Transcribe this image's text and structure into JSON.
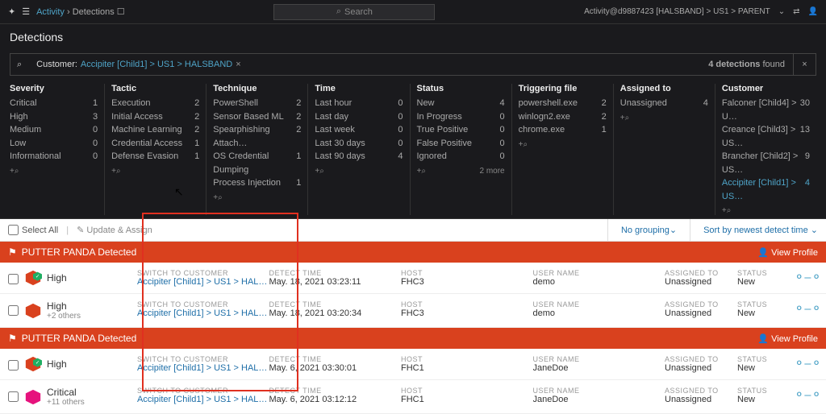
{
  "top": {
    "breadcrumb_root": "Activity",
    "breadcrumb_leaf": "Detections",
    "search_placeholder": "Search",
    "context": "Activity@d9887423  [HALSBAND] > US1 > PARENT"
  },
  "page_title": "Detections",
  "filter": {
    "label": "Customer:",
    "value": "Accipiter [Child1] > US1 > HALSBAND",
    "found_count": "4 detections",
    "found_suffix": "found"
  },
  "facets": [
    {
      "title": "Severity",
      "items": [
        [
          "Critical",
          "1"
        ],
        [
          "High",
          "3"
        ],
        [
          "Medium",
          "0"
        ],
        [
          "Low",
          "0"
        ],
        [
          "Informational",
          "0"
        ]
      ]
    },
    {
      "title": "Tactic",
      "items": [
        [
          "Execution",
          "2"
        ],
        [
          "Initial Access",
          "2"
        ],
        [
          "Machine Learning",
          "2"
        ],
        [
          "Credential Access",
          "1"
        ],
        [
          "Defense Evasion",
          "1"
        ]
      ]
    },
    {
      "title": "Technique",
      "items": [
        [
          "PowerShell",
          "2"
        ],
        [
          "Sensor Based ML",
          "2"
        ],
        [
          "Spearphishing Attach…",
          "2"
        ],
        [
          "OS Credential Dumping",
          "1"
        ],
        [
          "Process Injection",
          "1"
        ]
      ]
    },
    {
      "title": "Time",
      "items": [
        [
          "Last hour",
          "0"
        ],
        [
          "Last day",
          "0"
        ],
        [
          "Last week",
          "0"
        ],
        [
          "Last 30 days",
          "0"
        ],
        [
          "Last 90 days",
          "4"
        ]
      ]
    },
    {
      "title": "Status",
      "items": [
        [
          "New",
          "4"
        ],
        [
          "In Progress",
          "0"
        ],
        [
          "True Positive",
          "0"
        ],
        [
          "False Positive",
          "0"
        ],
        [
          "Ignored",
          "0"
        ]
      ],
      "more": "2 more"
    },
    {
      "title": "Triggering file",
      "items": [
        [
          "powershell.exe",
          "2"
        ],
        [
          "winlogn2.exe",
          "2"
        ],
        [
          "chrome.exe",
          "1"
        ]
      ]
    },
    {
      "title": "Assigned to",
      "items": [
        [
          "Unassigned",
          "4"
        ]
      ]
    },
    {
      "title": "Customer",
      "items": [
        [
          "Falconer [Child4] > U…",
          "30"
        ],
        [
          "Creance [Child3] > US…",
          "13"
        ],
        [
          "Brancher [Child2] > US…",
          "9"
        ],
        [
          "Accipiter [Child1] > US…",
          "4"
        ]
      ],
      "hl": 3
    }
  ],
  "toolbar": {
    "select_all": "Select All",
    "update": "Update & Assign",
    "grouping": "No grouping",
    "sort": "Sort by newest detect time"
  },
  "group_header": {
    "title": "PUTTER PANDA Detected",
    "view_profile": "View Profile"
  },
  "cols": {
    "switch": "SWITCH TO CUSTOMER",
    "detect": "DETECT TIME",
    "host": "HOST",
    "user": "USER NAME",
    "assigned": "ASSIGNED TO",
    "status": "STATUS"
  },
  "rows": [
    {
      "sev": "High",
      "sub": "",
      "hex": "#d9411e",
      "check": true,
      "link": "Accipiter [Child1] > US1 > HALSBA…",
      "time": "May. 18, 2021 03:23:11",
      "host": "FHC3",
      "user": "demo",
      "assigned": "Unassigned",
      "status": "New"
    },
    {
      "sev": "High",
      "sub": "+2 others",
      "hex": "#d9411e",
      "check": false,
      "link": "Accipiter [Child1] > US1 > HALSBA…",
      "time": "May. 18, 2021 03:20:34",
      "host": "FHC3",
      "user": "demo",
      "assigned": "Unassigned",
      "status": "New"
    }
  ],
  "rows2": [
    {
      "sev": "High",
      "sub": "",
      "hex": "#d9411e",
      "check": true,
      "link": "Accipiter [Child1] > US1 > HALSBA…",
      "time": "May. 6, 2021 03:30:01",
      "host": "FHC1",
      "user": "JaneDoe",
      "assigned": "Unassigned",
      "status": "New"
    },
    {
      "sev": "Critical",
      "sub": "+11 others",
      "hex": "#e6127d",
      "check": false,
      "link": "Accipiter [Child1] > US1 > HALSBA…",
      "time": "May. 6, 2021 03:12:12",
      "host": "FHC1",
      "user": "JaneDoe",
      "assigned": "Unassigned",
      "status": "New"
    }
  ]
}
